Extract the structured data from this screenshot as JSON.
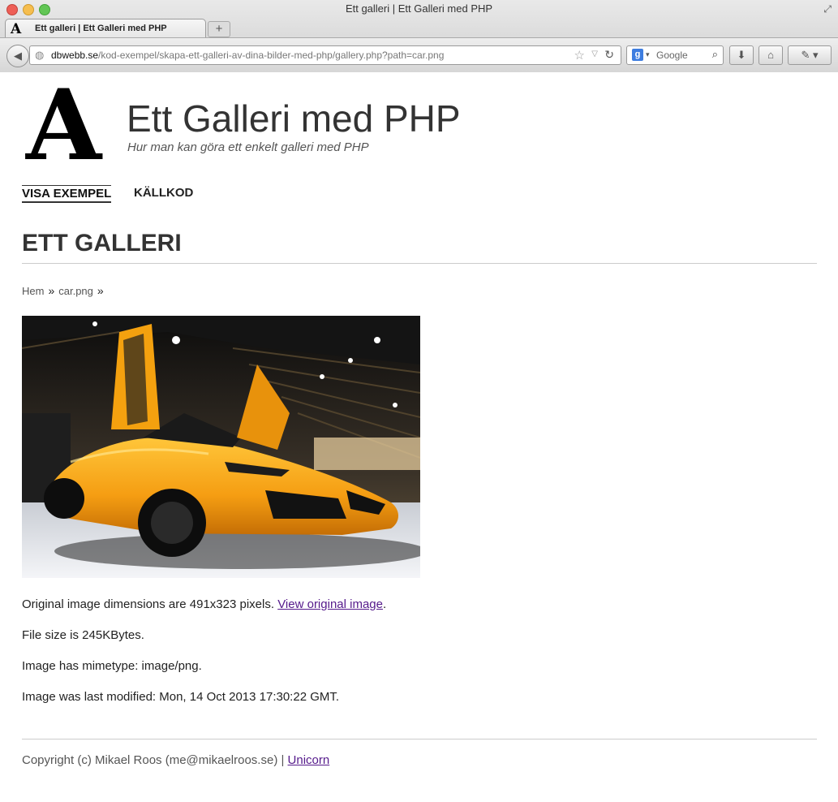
{
  "window": {
    "title": "Ett galleri | Ett Galleri med PHP"
  },
  "tab": {
    "label": "Ett galleri | Ett Galleri med PHP",
    "favicon_letter": "A",
    "new_tab": "+"
  },
  "address": {
    "domain": "dbwebb.se",
    "path": "/kod-exempel/skapa-ett-galleri-av-dina-bilder-med-php/gallery.php?path=car.png"
  },
  "search": {
    "engine_letter": "g",
    "placeholder": "Google"
  },
  "icons": {
    "back": "back-arrow-icon",
    "globe": "globe-icon",
    "star": "bookmark-star-icon",
    "reload": "reload-icon",
    "search": "magnifier-icon",
    "download": "download-icon",
    "home": "home-icon",
    "dev": "eyedropper-icon"
  },
  "site": {
    "logo_letter": "A",
    "title": "Ett Galleri med PHP",
    "slogan": "Hur man kan göra ett enkelt galleri med PHP"
  },
  "nav": {
    "items": [
      {
        "label": "VISA EXEMPEL"
      },
      {
        "label": "KÄLLKOD"
      }
    ]
  },
  "main": {
    "heading": "ETT GALLERI",
    "breadcrumb": {
      "home": "Hem",
      "sep": "»",
      "file": "car.png"
    },
    "info": {
      "dimensions_text": "Original image dimensions are 491x323 pixels.",
      "view_link": "View original image",
      "dot": ".",
      "filesize": "File size is 245KBytes.",
      "mimetype": "Image has mimetype: image/png.",
      "modified": "Image was last modified: Mon, 14 Oct 2013 17:30:22 GMT."
    }
  },
  "footer": {
    "copyright": "Copyright (c) Mikael Roos (me@mikaelroos.se) |",
    "link": "Unicorn"
  },
  "colors": {
    "link_visited": "#551a8b",
    "text": "#333333",
    "car": "#f7a41a"
  }
}
